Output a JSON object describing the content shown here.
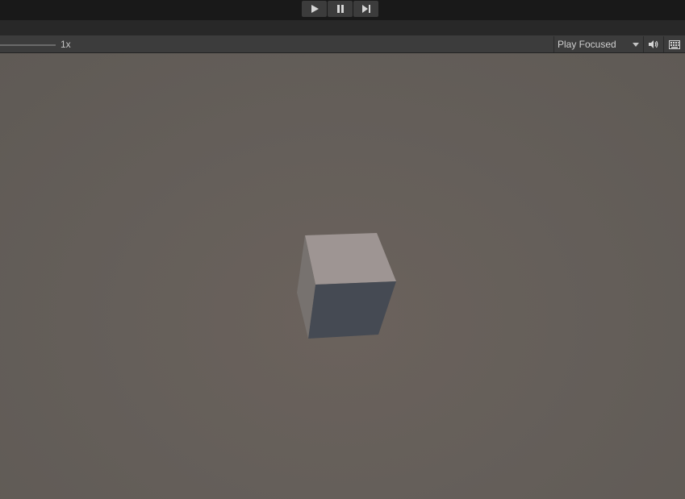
{
  "toolbar": {
    "play_controls": [
      {
        "icon": "play-icon"
      },
      {
        "icon": "pause-icon"
      },
      {
        "icon": "step-icon"
      }
    ]
  },
  "game_view": {
    "scale_label": "1x",
    "play_mode": {
      "selected": "Play Focused"
    },
    "icons": [
      "audio-icon",
      "keyboard-icon"
    ]
  },
  "colors": {
    "toolbar_bg": "#191919",
    "bar_bg": "#3c3c3c",
    "viewport_bg": "#655f5a",
    "cube_top": "#9e9593",
    "cube_front": "#454a53",
    "cube_left": "#77726f"
  }
}
